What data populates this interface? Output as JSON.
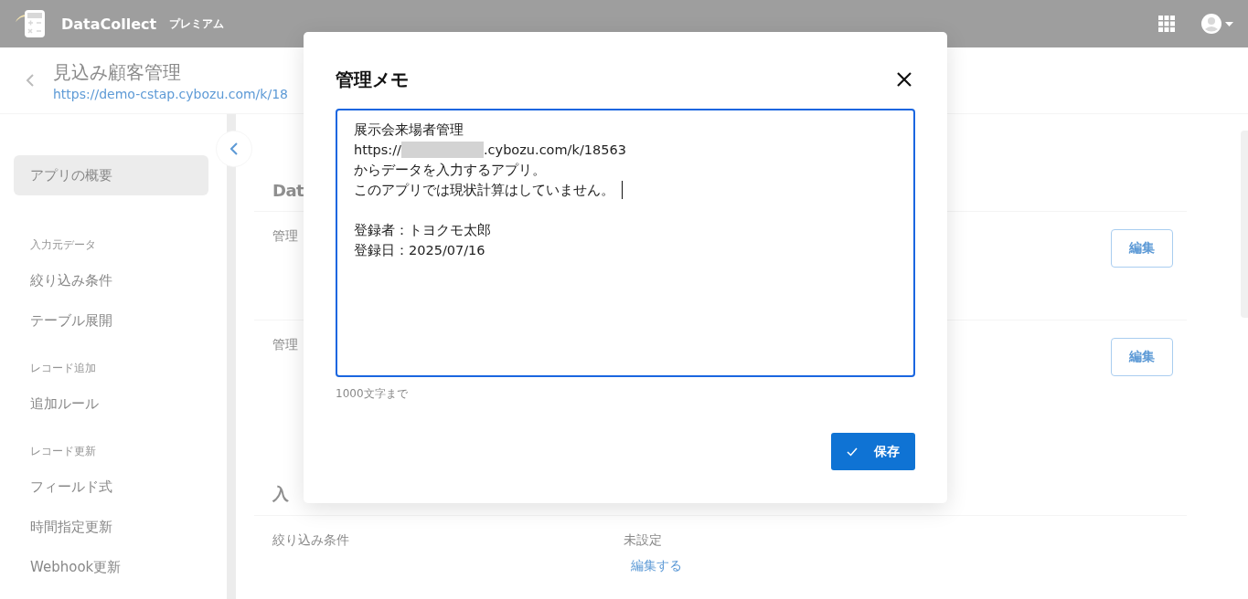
{
  "header": {
    "app_name": "DataCollect",
    "plan": "プレミアム"
  },
  "page": {
    "title": "見込み顧客管理",
    "url": "https://demo-cstap.cybozu.com/k/18"
  },
  "sidebar": {
    "items": [
      {
        "kind": "item",
        "label": "アプリの概要",
        "selected": true
      },
      {
        "kind": "group",
        "label": "入力元データ"
      },
      {
        "kind": "item",
        "label": "絞り込み条件",
        "selected": false
      },
      {
        "kind": "item",
        "label": "テーブル展開",
        "selected": false
      },
      {
        "kind": "group",
        "label": "レコード追加"
      },
      {
        "kind": "item",
        "label": "追加ルール",
        "selected": false
      },
      {
        "kind": "group",
        "label": "レコード更新"
      },
      {
        "kind": "item",
        "label": "フィールド式",
        "selected": false
      },
      {
        "kind": "item",
        "label": "時間指定更新",
        "selected": false
      },
      {
        "kind": "item",
        "label": "Webhook更新",
        "selected": false
      }
    ]
  },
  "content": {
    "sections": [
      {
        "heading": "Dat",
        "rows": [
          {
            "kind": "button",
            "label": "管理",
            "button": "編集"
          },
          {
            "kind": "button",
            "label": "管理",
            "button": "編集"
          }
        ]
      },
      {
        "heading": "入",
        "rows": [
          {
            "kind": "link",
            "label": "絞り込み条件",
            "value": "未設定",
            "link": "編集する"
          }
        ]
      }
    ]
  },
  "modal": {
    "title": "管理メモ",
    "memo_lines": [
      {
        "kind": "text",
        "text": "展示会来場者管理",
        "cursor": false
      },
      {
        "kind": "redacted_url",
        "before": "https://",
        "after": ".cybozu.com/k/18563"
      },
      {
        "kind": "text",
        "text": "からデータを入力するアプリ。",
        "cursor": false
      },
      {
        "kind": "text",
        "text": "このアプリでは現状計算はしていません。",
        "cursor": true
      },
      {
        "kind": "blank"
      },
      {
        "kind": "text",
        "text": "登録者：トヨクモ太郎",
        "cursor": false
      },
      {
        "kind": "text",
        "text": "登録日：2025/07/16",
        "cursor": false
      }
    ],
    "hint": "1000文字まで",
    "save_button": "保存"
  }
}
